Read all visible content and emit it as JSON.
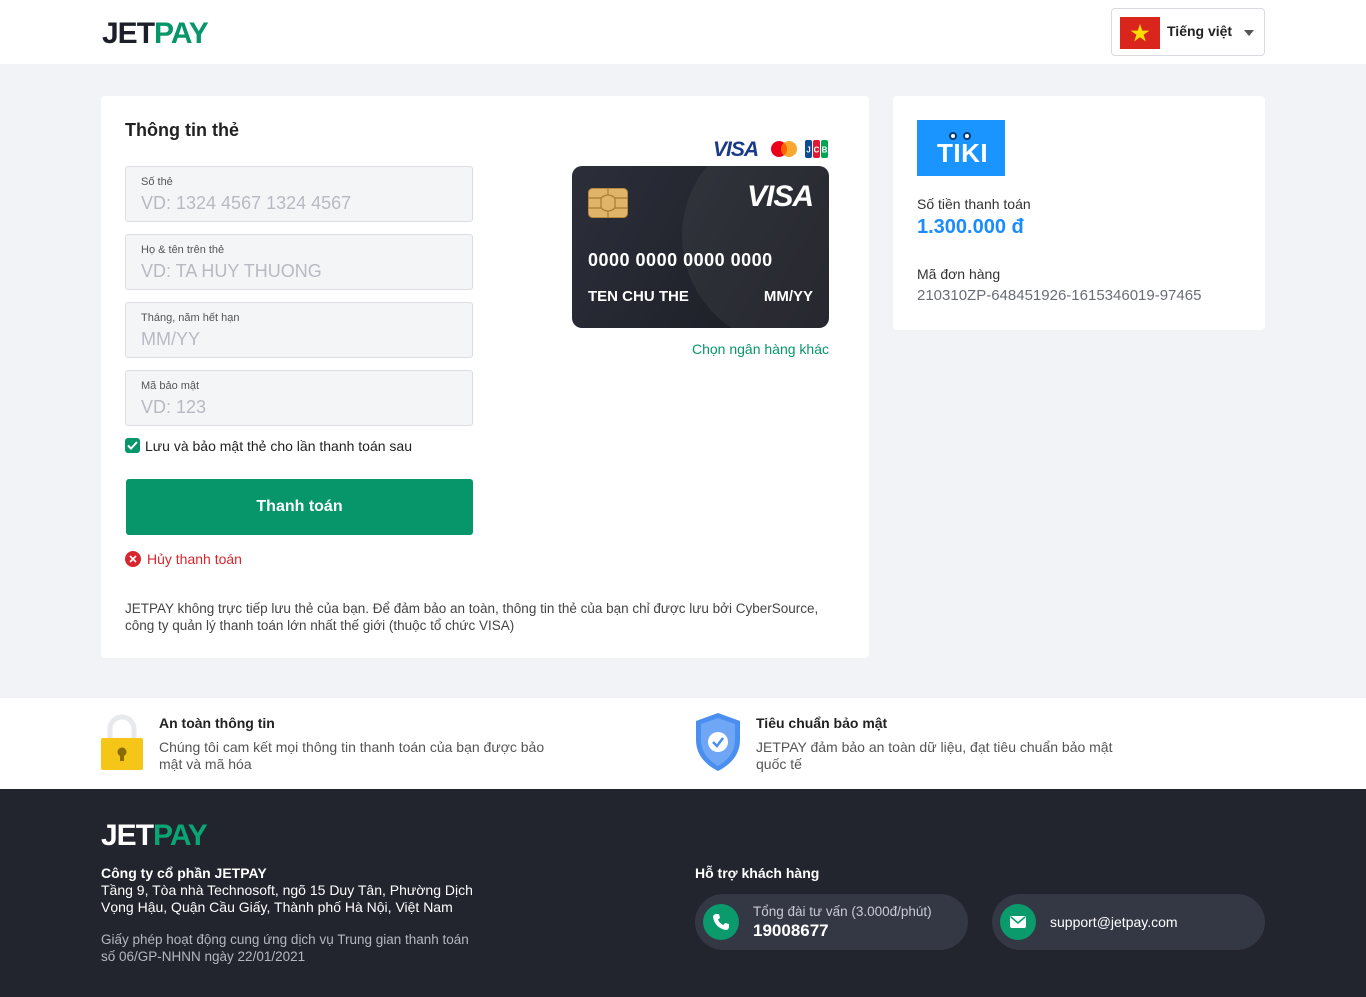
{
  "header": {
    "logo_jet": "JET",
    "logo_pay": "PAY",
    "language": "Tiếng việt"
  },
  "card_form": {
    "title": "Thông tin thẻ",
    "fields": [
      {
        "label": "Số thẻ",
        "placeholder": "VD: 1324 4567 1324 4567"
      },
      {
        "label": "Họ & tên trên thẻ",
        "placeholder": "VD: TA HUY THUONG"
      },
      {
        "label": "Tháng, năm hết hạn",
        "placeholder": "MM/YY"
      },
      {
        "label": "Mã bảo mật",
        "placeholder": "VD: 123"
      }
    ],
    "save_card_label": "Lưu và bảo mật thẻ cho lần thanh toán sau",
    "save_card_checked": true,
    "pay_button": "Thanh toán",
    "cancel_label": "Hủy thanh toán",
    "notice": "JETPAY không trực tiếp lưu thẻ của bạn. Để đảm bảo an toàn, thông tin thẻ của bạn chỉ được lưu bởi CyberSource, công ty quản lý thanh toán lớn nhất thế giới (thuộc tổ chức VISA)",
    "accepted_brands": [
      "VISA",
      "Mastercard",
      "JCB"
    ],
    "brand_visa_text": "VISA"
  },
  "card_preview": {
    "brand": "VISA",
    "number": "0000 0000 0000 0000",
    "holder": "TEN CHU THE",
    "expiry": "MM/YY"
  },
  "other_bank_link": "Chọn ngân hàng khác",
  "order": {
    "merchant_logo_text": "TIKI",
    "amount_label": "Số tiền thanh toán",
    "amount": "1.300.000 đ",
    "order_code_label": "Mã đơn hàng",
    "order_code": "210310ZP-648451926-1615346019-97465"
  },
  "security": [
    {
      "title": "An toàn thông tin",
      "text": "Chúng tôi cam kết mọi thông tin thanh toán của bạn được bảo mật và mã hóa",
      "icon": "lock-icon"
    },
    {
      "title": "Tiêu chuẩn bảo mật",
      "text": "JETPAY đảm bảo an toàn dữ liệu, đạt tiêu chuẩn bảo mật quốc tế",
      "icon": "shield-check-icon"
    }
  ],
  "footer": {
    "logo_jet": "JET",
    "logo_pay": "PAY",
    "company": "Công ty cổ phần JETPAY",
    "address": "Tầng 9, Tòa nhà Technosoft, ngõ 15 Duy Tân, Phường Dịch Vọng Hậu, Quận Cầu Giấy, Thành phố Hà Nội, Việt Nam",
    "license": "Giấy phép hoạt động cung ứng dịch vụ Trung gian thanh toán số 06/GP-NHNN ngày 22/01/2021",
    "support_title": "Hỗ trợ khách hàng",
    "hotline_label": "Tổng đài tư vấn (3.000đ/phút)",
    "hotline": "19008677",
    "email": "support@jetpay.com"
  },
  "colors": {
    "brand_green": "#079669",
    "amount_blue": "#1a8cff",
    "cancel_red": "#d7262d",
    "footer_bg": "#22242e"
  }
}
